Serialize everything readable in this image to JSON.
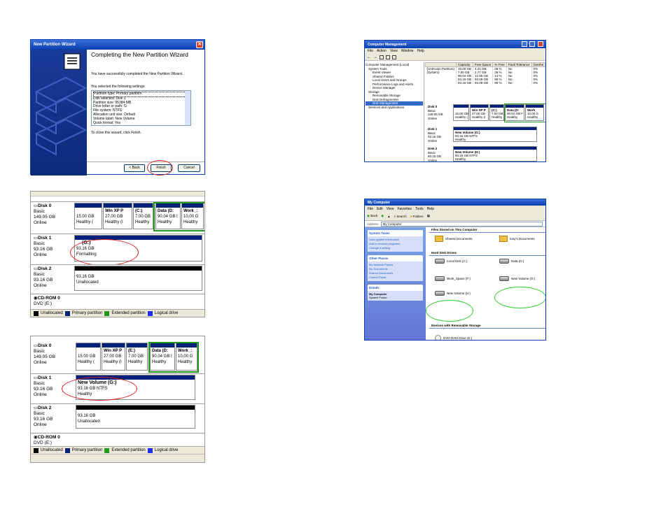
{
  "wizard": {
    "title": "New Partition Wizard",
    "heading": "Completing the New Partition Wizard",
    "success_text": "You have successfully completed the New Partition Wizard.",
    "selected_label": "You selected the following settings:",
    "settings": [
      "Partition type: Primary partition",
      "Disk selected: Disk 1",
      "Partition size: 95384 MB",
      "Drive letter or path: G:",
      "File system: NTFS",
      "Allocation unit size: Default",
      "Volume label: New Volume",
      "Quick format: Yes"
    ],
    "close_text": "To close this wizard, click Finish.",
    "back_label": "< Back",
    "finish_label": "Finish",
    "cancel_label": "Cancel"
  },
  "dm1": {
    "disk0": {
      "name": "Disk 0",
      "type": "Basic",
      "size": "149.05 GB",
      "status": "Online",
      "parts": [
        {
          "name": "",
          "size": "15.00 GB",
          "status": "Healthy ("
        },
        {
          "name": "Win XP P",
          "size": "27.00 GB",
          "status": "Healthy (I"
        },
        {
          "name": "(C:)",
          "size": "7.00 GB",
          "status": "Healthy"
        },
        {
          "name": "Data  (D:",
          "size": "90.04 GB I",
          "status": "Healthy"
        },
        {
          "name": "Work_:",
          "size": "10.00 G",
          "status": "Healthy"
        }
      ]
    },
    "disk1": {
      "name": "Disk 1",
      "type": "Basic",
      "size": "93.16 GB",
      "status": "Online",
      "part": {
        "name": "(G:)",
        "size": "93.16 GB",
        "status": "Formatting"
      }
    },
    "disk2": {
      "name": "Disk 2",
      "type": "Basic",
      "size": "93.16 GB",
      "status": "Online",
      "part": {
        "size": "93.16 GB",
        "status": "Unallocated"
      }
    },
    "cdrom": {
      "name": "CD-ROM 0",
      "sub": "DVD (E:)"
    },
    "legend": [
      "Unallocated",
      "Primary partition",
      "Extended partition",
      "Logical drive"
    ]
  },
  "dm2": {
    "disk0": {
      "name": "Disk 0",
      "type": "Basic",
      "size": "149.05 GB",
      "status": "Online",
      "parts": [
        {
          "name": "",
          "size": "15.00 GB",
          "status": "Healthy ("
        },
        {
          "name": "Win XP P",
          "size": "27.00 GB",
          "status": "Healthy (I"
        },
        {
          "name": "(E:)",
          "size": "7.00 GB",
          "status": "Healthy"
        },
        {
          "name": "Data  (D:",
          "size": "90.04 GB I",
          "status": "Healthy"
        },
        {
          "name": "Work_:",
          "size": "10.00 G",
          "status": "Healthy"
        }
      ]
    },
    "disk1": {
      "name": "Disk 1",
      "type": "Basic",
      "size": "93.16 GB",
      "status": "Online",
      "part": {
        "name": "New Volume  (G:)",
        "size": "93.16 GB NTFS",
        "status": "Healthy"
      }
    },
    "disk2": {
      "name": "Disk 2",
      "type": "Basic",
      "size": "93.16 GB",
      "status": "Online",
      "part": {
        "size": "93.16 GB",
        "status": "Unallocated"
      }
    },
    "cdrom": {
      "name": "CD-ROM 0",
      "sub": "DVD (E:)"
    },
    "legend": [
      "Unallocated",
      "Primary partition",
      "Extended partition",
      "Logical drive"
    ]
  },
  "cm": {
    "title": "Computer Management",
    "menu": [
      "File",
      "Action",
      "View",
      "Window",
      "Help"
    ],
    "tree": [
      "Computer Management (Local)",
      "System Tools",
      "Event Viewer",
      "Shared Folders",
      "Local Users and Groups",
      "Performance Logs and Alerts",
      "Device Manager",
      "Storage",
      "Removable Storage",
      "Disk Defragmenter",
      "Disk Management",
      "Services and Applications"
    ],
    "cols": [
      "Capacity",
      "Free Space",
      "% Free",
      "Fault Tolerance",
      "Overhe"
    ],
    "rows": [
      [
        "(Unknown Partition)",
        "15.00 GB",
        "4.21 GB",
        "28 %",
        "No",
        "0%"
      ],
      [
        "(System)",
        "7.00 GB",
        "2.77 GB",
        "39 %",
        "No",
        "0%"
      ],
      [
        "",
        "90.04 GB",
        "12.65 GB",
        "14 %",
        "No",
        "0%"
      ],
      [
        "",
        "93.16 GB",
        "93.09 GB",
        "99 %",
        "No",
        "0%"
      ],
      [
        "",
        "93.16 GB",
        "93.09 GB",
        "99 %",
        "No",
        "0%"
      ]
    ],
    "disk0": {
      "name": "Disk 0",
      "type": "Basic",
      "size": "149.05 GB",
      "status": "Online",
      "parts": [
        {
          "name": "",
          "size": "15.00 GB",
          "status": "Healthy ("
        },
        {
          "name": "Win XP P",
          "size": "27.00 GB",
          "status": "Healthy (I"
        },
        {
          "name": "(C:)",
          "size": "7.00 GB",
          "status": "Healthy"
        },
        {
          "name": "Data (D:",
          "size": "90.04 GB F",
          "status": "Healthy"
        },
        {
          "name": "Work_",
          "size": "10.00 G",
          "status": "Healthy"
        }
      ]
    },
    "disk1": {
      "name": "Disk 1",
      "type": "Basic",
      "size": "93.16 GB",
      "status": "Online",
      "part": {
        "name": "New Volume (G:)",
        "size": "93.16 GB NTFS",
        "status": "Healthy"
      }
    },
    "disk2": {
      "name": "Disk 2",
      "type": "Basic",
      "size": "93.16 GB",
      "status": "Online",
      "part": {
        "name": "New Volume (H:)",
        "size": "93.16 GB NTFS",
        "status": "Healthy"
      }
    }
  },
  "mc": {
    "title": "My Computer",
    "menu": [
      "File",
      "Edit",
      "View",
      "Favorites",
      "Tools",
      "Help"
    ],
    "back": "Back",
    "search": "Search",
    "folders": "Folders",
    "address_label": "Address",
    "address": "My Computer",
    "system_tasks": "System Tasks",
    "tasks": [
      "View system information",
      "Add or remove programs",
      "Change a setting"
    ],
    "other_places": "Other Places",
    "places": [
      "My Network Places",
      "My Documents",
      "Shared Documents",
      "Control Panel"
    ],
    "details": "Details",
    "details_name": "My Computer",
    "details_sub": "System Folder",
    "files_header": "Files Stored on This Computer",
    "shared_docs": "Shared Documents",
    "user_docs": "tony's Documents",
    "hdd_header": "Hard Disk Drives",
    "drives": [
      "Local Disk (C:)",
      "Data (D:)",
      "Work_Space (F:)",
      "New Volume (G:)",
      "New Volume (H:)"
    ],
    "removable_header": "Devices with Removable Storage",
    "dvd": "DVD-RAM Drive (E:)"
  },
  "colors": {
    "xp_blue": "#0a3fb0",
    "primary": "#00207a",
    "extended": "#1f9a1f",
    "red_mark": "#e02020",
    "green_mark": "#2fcf2f"
  }
}
